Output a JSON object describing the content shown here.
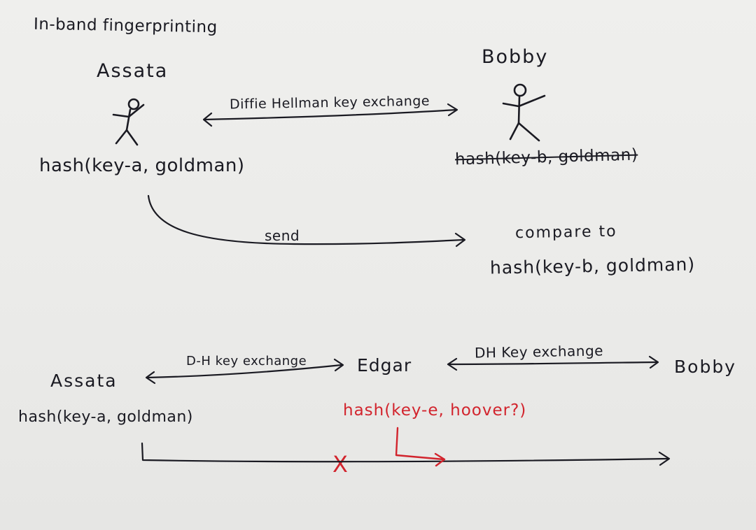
{
  "title": "In-band fingerprinting",
  "colors": {
    "ink": "#1a1a22",
    "red_ink": "#d2242d",
    "paper": "#ededeb"
  },
  "scenario_1": {
    "left_party": "Assata",
    "right_party": "Bobby",
    "exchange_label": "Diffie Hellman key exchange",
    "left_hash": "hash(key-a, goldman)",
    "right_hash_struck": "hash(key-b, goldman)",
    "send_label": "send",
    "compare_label": "compare to",
    "compare_hash": "hash(key-b, goldman)"
  },
  "scenario_2": {
    "left_party": "Assata",
    "middle_party": "Edgar",
    "right_party": "Bobby",
    "left_exchange_label": "D-H key exchange",
    "right_exchange_label": "DH Key exchange",
    "left_hash": "hash(key-a, goldman)",
    "attacker_hash": "hash(key-e, hoover?)",
    "blocked_mark": "X"
  }
}
